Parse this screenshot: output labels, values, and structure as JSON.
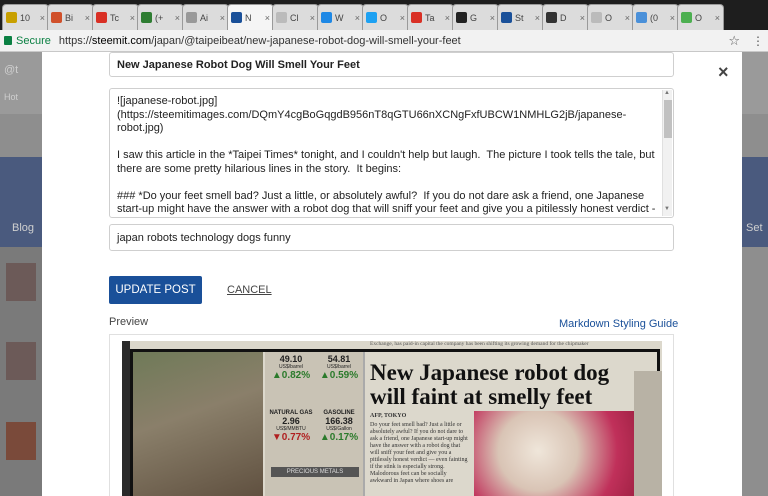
{
  "browser": {
    "tabs": [
      {
        "label": "10",
        "color": "#c8a000",
        "icon": "crown-icon"
      },
      {
        "label": "Bi",
        "color": "#d0502a",
        "icon": "app-icon"
      },
      {
        "label": "Tc",
        "color": "#d93025",
        "icon": "gmail-icon"
      },
      {
        "label": "(+",
        "color": "#2e7d32",
        "icon": "green-icon"
      },
      {
        "label": "Ai",
        "color": "#999999",
        "icon": "page-icon"
      },
      {
        "label": "N",
        "color": "#1a5099",
        "icon": "steemit-icon",
        "active": true
      },
      {
        "label": "Cl",
        "color": "#bbbbbb",
        "icon": "globe-icon"
      },
      {
        "label": "W",
        "color": "#1e88e5",
        "icon": "diamond-icon"
      },
      {
        "label": "O",
        "color": "#1da1f2",
        "icon": "twitter-icon"
      },
      {
        "label": "Ta",
        "color": "#d93025",
        "icon": "gmail-icon"
      },
      {
        "label": "G",
        "color": "#222222",
        "icon": "bookmark-icon"
      },
      {
        "label": "St",
        "color": "#1a5099",
        "icon": "steemit-icon"
      },
      {
        "label": "D",
        "color": "#333333",
        "icon": "page-icon"
      },
      {
        "label": "O",
        "color": "#bbbbbb",
        "icon": "globe-icon"
      },
      {
        "label": "(0",
        "color": "#4a90d9",
        "icon": "app-icon"
      },
      {
        "label": "O",
        "color": "#4caf50",
        "icon": "green-icon"
      }
    ],
    "tab_close_glyph": "×",
    "secure_label": "Secure",
    "url_scheme": "https://",
    "url_host": "steemit.com",
    "url_path": "/japan/@taipeibeat/new-japanese-robot-dog-will-smell-your-feet",
    "star_glyph": "☆",
    "menu_glyph": "⋮",
    "accent_secure": "#0b8043"
  },
  "background": {
    "left_label": "Blog",
    "right_label": "Set",
    "corner_label": "@t",
    "sub_label": "Hot"
  },
  "editor": {
    "close_glyph": "×",
    "title": "New Japanese Robot Dog Will Smell Your Feet",
    "body": "![japanese-robot.jpg](https://steemitimages.com/DQmY4cgBoGqgdB956nT8qGTU66nXCNgFxfUBCW1NMHLG2jB/japanese-robot.jpg)\n\nI saw this article in the *Taipei Times* tonight, and I couldn't help but laugh.  The picture I took tells the tale, but there are some pretty hilarious lines in the story.  It begins:\n\n### *Do your feet smell bad? Just a little, or absolutely awful?  If you do not dare ask a friend, one Japanese start-up might have the answer with a robot dog that will sniff your feet and give you a pitilessly honest verdict -- even fainting if the stink is especially strong!* ###\n###\nBecause as we all know",
    "tags": "japan robots technology dogs funny",
    "update_label": "UPDATE POST",
    "cancel_label": "CANCEL",
    "preview_label": "Preview",
    "guide_label": "Markdown Styling Guide",
    "accent": "#1a5099"
  },
  "preview_image": {
    "headline_line1": "New Japanese robot dog",
    "headline_line2": "will faint at smelly feet",
    "metals_label": "PRECIOUS METALS",
    "quotes": [
      {
        "value": "49.10",
        "unit": "US$/barrel",
        "change": "0.82%",
        "dir": "up"
      },
      {
        "value": "54.81",
        "unit": "US$/barrel",
        "change": "0.59%",
        "dir": "up"
      },
      {
        "label": "NATURAL GAS",
        "value": "2.96",
        "unit": "US$/MMBTU",
        "change": "0.77%",
        "dir": "down"
      },
      {
        "label": "GASOLINE",
        "value": "166.38",
        "unit": "US$/Gallon",
        "change": "0.17%",
        "dir": "up"
      }
    ],
    "byline": "AFP, TOKYO",
    "article_text": "Do your feet smell bad? Just a little or absolutely awful? If you do not dare to ask a friend, one Japanese start-up might have the answer with a robot dog that will sniff your feet and give you a pitilessly honest verdict — even fainting if the stink is especially strong. Malodorous feet can be socially awkward in Japan where shoes are"
  }
}
